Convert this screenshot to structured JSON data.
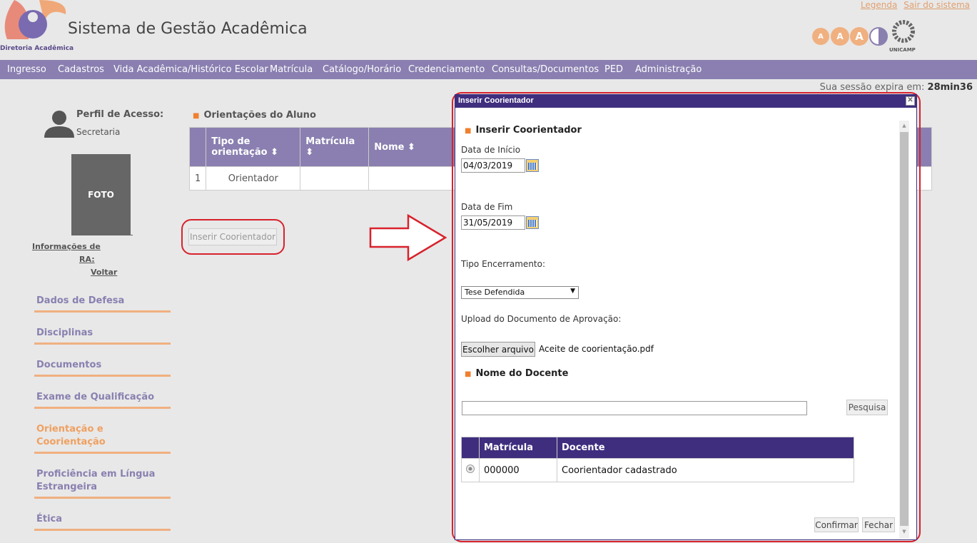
{
  "header": {
    "title": "Sistema de Gestão Acadêmica",
    "logo_subtitle": "Diretoria Acadêmica",
    "link_legend": "Legenda",
    "link_logout": "Sair do sistema",
    "font_sizes": [
      "A",
      "A",
      "A"
    ],
    "unicamp_label": "UNICAMP"
  },
  "nav": {
    "items": [
      "Ingresso",
      "Cadastros",
      "Vida Acadêmica/Histórico Escolar",
      "Matrícula",
      "Catálogo/Horário",
      "Credenciamento",
      "Consultas/Documentos",
      "PED",
      "Administração"
    ]
  },
  "session": {
    "label": "Sua sessão expira em:",
    "value": "28min36"
  },
  "sidebar": {
    "profile_label": "Perfil de Acesso:",
    "profile_value": "Secretaria",
    "photo_label": "FOTO",
    "info_link_1": "Informações de",
    "info_link_2": "RA:",
    "back_link": "Voltar",
    "items": [
      {
        "label": "Dados de Defesa",
        "active": false
      },
      {
        "label": "Disciplinas",
        "active": false
      },
      {
        "label": "Documentos",
        "active": false
      },
      {
        "label": "Exame de Qualificação",
        "active": false
      },
      {
        "label": "Orientação e Coorientação",
        "active": true
      },
      {
        "label": "Proficiência em Língua Estrangeira",
        "active": false
      },
      {
        "label": "Ética",
        "active": false
      }
    ]
  },
  "main": {
    "section_title": "Orientações do Aluno",
    "table": {
      "columns": [
        "Tipo de orientação ⬍",
        "Matrícula ⬍",
        "Nome ⬍"
      ],
      "rows": [
        [
          "1",
          "Orientador",
          "",
          ""
        ]
      ]
    },
    "insert_button": "Inserir Coorientador"
  },
  "modal": {
    "window_title": "Inserir Coorientador",
    "close_glyph": "✕",
    "section_title": "Inserir Coorientador",
    "start_label": "Data de Início",
    "start_value": "04/03/2019",
    "end_label": "Data de Fim",
    "end_value": "31/05/2019",
    "closure_label": "Tipo Encerramento:",
    "closure_value": "Tese Defendida",
    "upload_label": "Upload do Documento de Aprovação:",
    "file_button": "Escolher arquivo",
    "file_name": "Aceite de coorientação.pdf",
    "docente_section": "Nome do Docente",
    "docente_value": "",
    "search_button": "Pesquisa",
    "results": {
      "columns": [
        "Matrícula",
        "Docente"
      ],
      "rows": [
        [
          "000000",
          "Coorientador cadastrado"
        ]
      ]
    },
    "confirm_button": "Confirmar",
    "close_button": "Fechar"
  },
  "colors": {
    "nav_bg": "#8a7fb0",
    "modal_header": "#3f2e7e",
    "accent_orange": "#f0b080",
    "highlight_red": "#d8222c"
  }
}
